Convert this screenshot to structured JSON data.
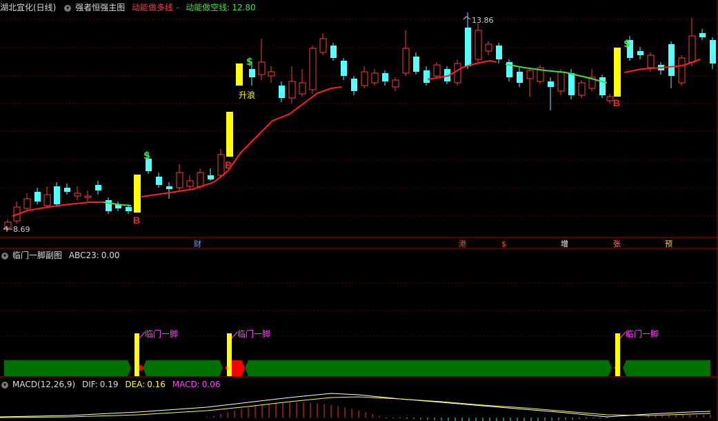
{
  "main": {
    "stock_name": "湖北宜化(日线)",
    "indicator_name": "强者恒强主图",
    "line1_label": "动能做多线",
    "line1_value": "-",
    "line2_label": "动能做空线:",
    "line2_value": "12.80",
    "high_label": "13.86",
    "low_label": "8.69",
    "signal_B": "B",
    "signal_dollar": "$",
    "wave_label": "升浪",
    "events": [
      "财",
      "港",
      "$",
      "增",
      "张",
      "预"
    ],
    "colors": {
      "up": "#ff3b3b",
      "down": "#54ffff",
      "ma_up": "#ff2020",
      "ma_down": "#40e040",
      "signal": "#ffff00"
    }
  },
  "sub": {
    "indicator_name": "临门一脚副图",
    "abc_label": "ABC23:",
    "abc_value": "0.00",
    "signal_label": "临门一脚"
  },
  "macd": {
    "name": "MACD(12,26,9)",
    "dif_label": "DIF:",
    "dif_value": "0.19",
    "dea_label": "DEA:",
    "dea_value": "0.16",
    "macd_label": "MACD:",
    "macd_value": "0.06"
  }
}
